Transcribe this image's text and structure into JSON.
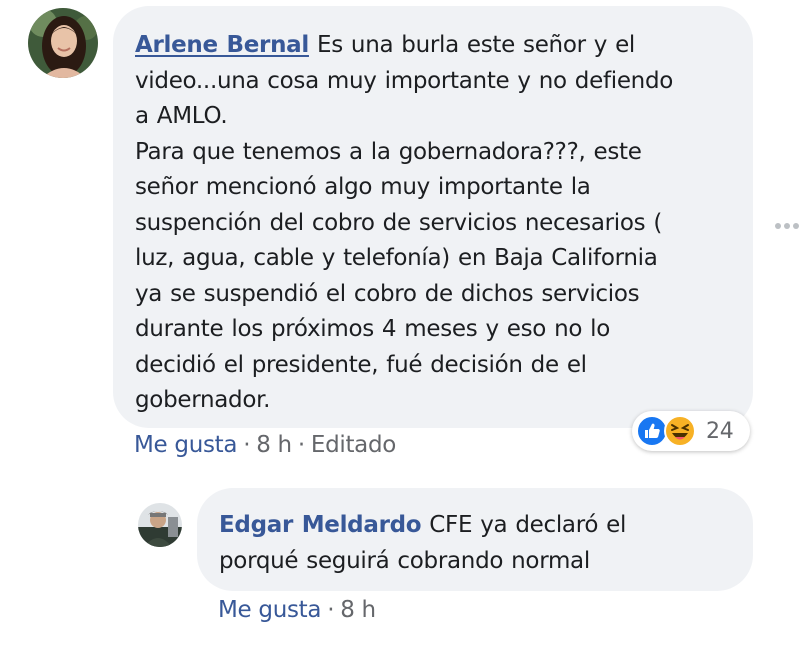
{
  "comment": {
    "author": "Arlene Bernal",
    "text_lines": [
      "Es una burla este señor y el",
      "video...una cosa muy importante y no defiendo",
      "a AMLO.",
      "Para que tenemos a la gobernadora???, este",
      "señor mencionó algo muy importante la",
      "suspención del cobro de servicios necesarios (",
      "luz, agua, cable y telefonía) en Baja California",
      "ya se suspendió el cobro de dichos servicios",
      "durante los próximos 4 meses y eso no lo",
      "decidió el presidente, fué decisión de el",
      "gobernador."
    ],
    "like_label": "Me gusta",
    "separator": "·",
    "time": "8 h",
    "edited": "Editado",
    "reactions": {
      "icons": [
        "like-icon",
        "haha-icon"
      ],
      "count": "24",
      "like_color": "#1877f2",
      "haha_color": "#f7b125"
    }
  },
  "reply": {
    "author": "Edgar Meldardo",
    "text_lines": [
      "CFE ya declaró el",
      "porqué seguirá cobrando normal"
    ],
    "like_label": "Me gusta",
    "separator": "·",
    "time": "8 h"
  },
  "colors": {
    "author": "#385898",
    "bubble": "#f0f2f5",
    "meta": "#65676b"
  }
}
